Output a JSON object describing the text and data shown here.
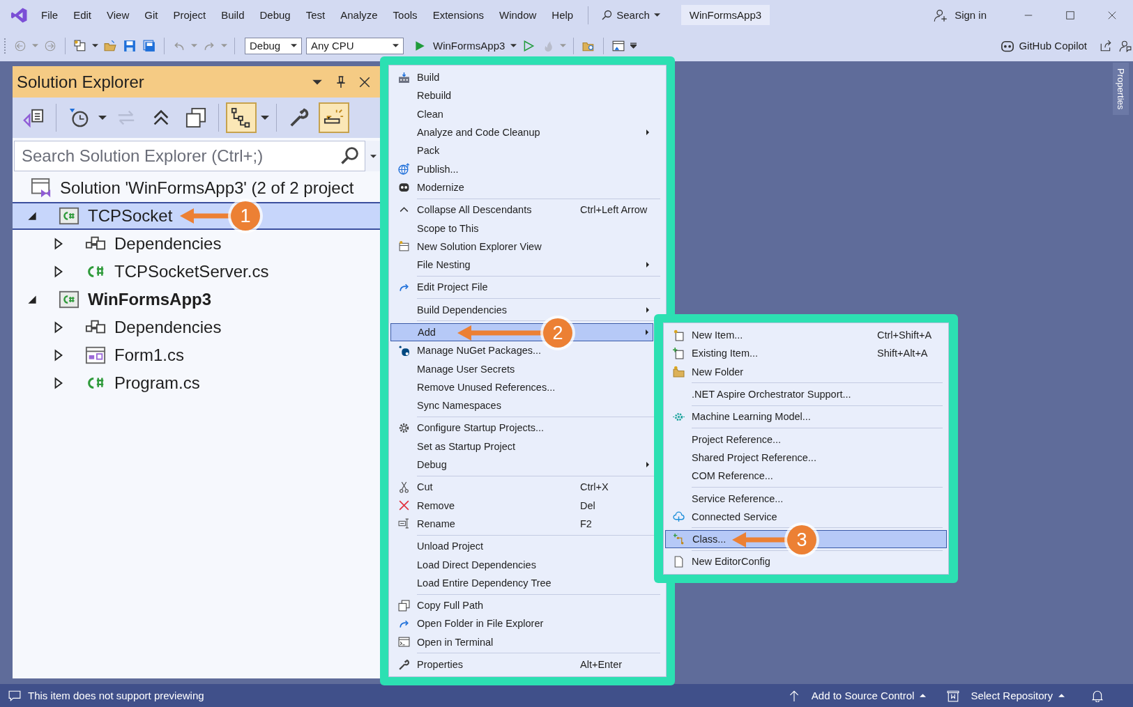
{
  "title_bar": {
    "menus": [
      "File",
      "Edit",
      "View",
      "Git",
      "Project",
      "Build",
      "Debug",
      "Test",
      "Analyze",
      "Tools",
      "Extensions",
      "Window",
      "Help"
    ],
    "search": "Search",
    "solution": "WinFormsApp3",
    "sign_in": "Sign in"
  },
  "toolbar": {
    "configuration": "Debug",
    "platform": "Any CPU",
    "startup": "WinFormsApp3",
    "copilot": "GitHub Copilot"
  },
  "solution_explorer": {
    "title": "Solution Explorer",
    "tools": [
      {
        "kind": "home",
        "on": false,
        "disabled": false
      },
      {
        "kind": "history",
        "on": false,
        "disabled": false
      },
      {
        "kind": "sync",
        "on": false,
        "disabled": true
      },
      {
        "kind": "collapse",
        "on": false,
        "disabled": false
      },
      {
        "kind": "show_all",
        "on": false,
        "disabled": false
      },
      {
        "kind": "track",
        "on": true,
        "disabled": false
      },
      {
        "kind": "properties",
        "on": false,
        "disabled": false
      },
      {
        "kind": "preview",
        "on": true,
        "disabled": false
      }
    ],
    "search": {
      "placeholder": "Search Solution Explorer (Ctrl+;)"
    },
    "tree": [
      {
        "label": "Solution 'WinFormsApp3' (2 of 2 project",
        "kind": "solution",
        "selected": false,
        "children": [
          {
            "label": "TCPSocket",
            "kind": "project",
            "expanded": true,
            "selected": true,
            "startup": false,
            "children": [
              {
                "label": "Dependencies",
                "kind": "dependencies",
                "expanded": false,
                "selected": false
              },
              {
                "label": "TCPSocketServer.cs",
                "kind": "csharp",
                "expanded": false,
                "selected": false
              }
            ]
          },
          {
            "label": "WinFormsApp3",
            "kind": "project",
            "expanded": true,
            "selected": false,
            "startup": true,
            "children": [
              {
                "label": "Dependencies",
                "kind": "dependencies",
                "expanded": false,
                "selected": false
              },
              {
                "label": "Form1.cs",
                "kind": "form",
                "expanded": false,
                "selected": false
              },
              {
                "label": "Program.cs",
                "kind": "csharp",
                "expanded": false,
                "selected": false
              }
            ]
          }
        ]
      }
    ]
  },
  "context_menu": {
    "groups": [
      [
        {
          "label": "Build",
          "submenu": false,
          "selected": false
        },
        {
          "label": "Rebuild",
          "submenu": false,
          "selected": false
        },
        {
          "label": "Clean",
          "submenu": false,
          "selected": false
        },
        {
          "label": "Analyze and Code Cleanup",
          "submenu": true,
          "selected": false
        },
        {
          "label": "Pack",
          "submenu": false,
          "selected": false
        },
        {
          "label": "Publish...",
          "submenu": false,
          "selected": false
        },
        {
          "label": "Modernize",
          "submenu": false,
          "selected": false
        }
      ],
      [
        {
          "label": "Collapse All Descendants",
          "shortcut": "Ctrl+Left Arrow",
          "submenu": false,
          "selected": false
        },
        {
          "label": "Scope to This",
          "submenu": false,
          "selected": false
        },
        {
          "label": "New Solution Explorer View",
          "submenu": false,
          "selected": false
        },
        {
          "label": "File Nesting",
          "submenu": true,
          "selected": false
        }
      ],
      [
        {
          "label": "Edit Project File",
          "submenu": false,
          "selected": false
        }
      ],
      [
        {
          "label": "Build Dependencies",
          "submenu": true,
          "selected": false
        }
      ],
      [
        {
          "label": "Add",
          "submenu": true,
          "selected": true
        },
        {
          "label": "Manage NuGet Packages...",
          "submenu": false,
          "selected": false
        },
        {
          "label": "Manage User Secrets",
          "submenu": false,
          "selected": false
        },
        {
          "label": "Remove Unused References...",
          "submenu": false,
          "selected": false
        },
        {
          "label": "Sync Namespaces",
          "submenu": false,
          "selected": false
        }
      ],
      [
        {
          "label": "Configure Startup Projects...",
          "submenu": false,
          "selected": false
        },
        {
          "label": "Set as Startup Project",
          "submenu": false,
          "selected": false
        },
        {
          "label": "Debug",
          "submenu": true,
          "selected": false
        }
      ],
      [
        {
          "label": "Cut",
          "shortcut": "Ctrl+X",
          "submenu": false,
          "selected": false
        },
        {
          "label": "Remove",
          "shortcut": "Del",
          "submenu": false,
          "selected": false
        },
        {
          "label": "Rename",
          "shortcut": "F2",
          "submenu": false,
          "selected": false
        }
      ],
      [
        {
          "label": "Unload Project",
          "submenu": false,
          "selected": false
        },
        {
          "label": "Load Direct Dependencies",
          "submenu": false,
          "selected": false
        },
        {
          "label": "Load Entire Dependency Tree",
          "submenu": false,
          "selected": false
        }
      ],
      [
        {
          "label": "Copy Full Path",
          "submenu": false,
          "selected": false
        },
        {
          "label": "Open Folder in File Explorer",
          "submenu": false,
          "selected": false
        },
        {
          "label": "Open in Terminal",
          "submenu": false,
          "selected": false
        }
      ],
      [
        {
          "label": "Properties",
          "shortcut": "Alt+Enter",
          "submenu": false,
          "selected": false
        }
      ]
    ]
  },
  "add_submenu": {
    "groups": [
      [
        {
          "label": "New Item...",
          "shortcut": "Ctrl+Shift+A",
          "selected": false
        },
        {
          "label": "Existing Item...",
          "shortcut": "Shift+Alt+A",
          "selected": false
        },
        {
          "label": "New Folder",
          "selected": false
        }
      ],
      [
        {
          "label": ".NET Aspire Orchestrator Support...",
          "selected": false
        }
      ],
      [
        {
          "label": "Machine Learning Model...",
          "selected": false
        }
      ],
      [
        {
          "label": "Project Reference...",
          "selected": false
        },
        {
          "label": "Shared Project Reference...",
          "selected": false
        },
        {
          "label": "COM Reference...",
          "selected": false
        }
      ],
      [
        {
          "label": "Service Reference...",
          "selected": false
        },
        {
          "label": "Connected Service",
          "selected": false
        }
      ],
      [
        {
          "label": "Class...",
          "selected": true
        }
      ],
      [
        {
          "label": "New EditorConfig",
          "selected": false
        }
      ]
    ]
  },
  "callouts": [
    {
      "number": "1"
    },
    {
      "number": "2"
    },
    {
      "number": "3"
    }
  ],
  "properties_tab": "Properties",
  "status_bar": {
    "message": "This item does not support previewing",
    "source_control": "Add to Source Control",
    "repository": "Select Repository"
  }
}
